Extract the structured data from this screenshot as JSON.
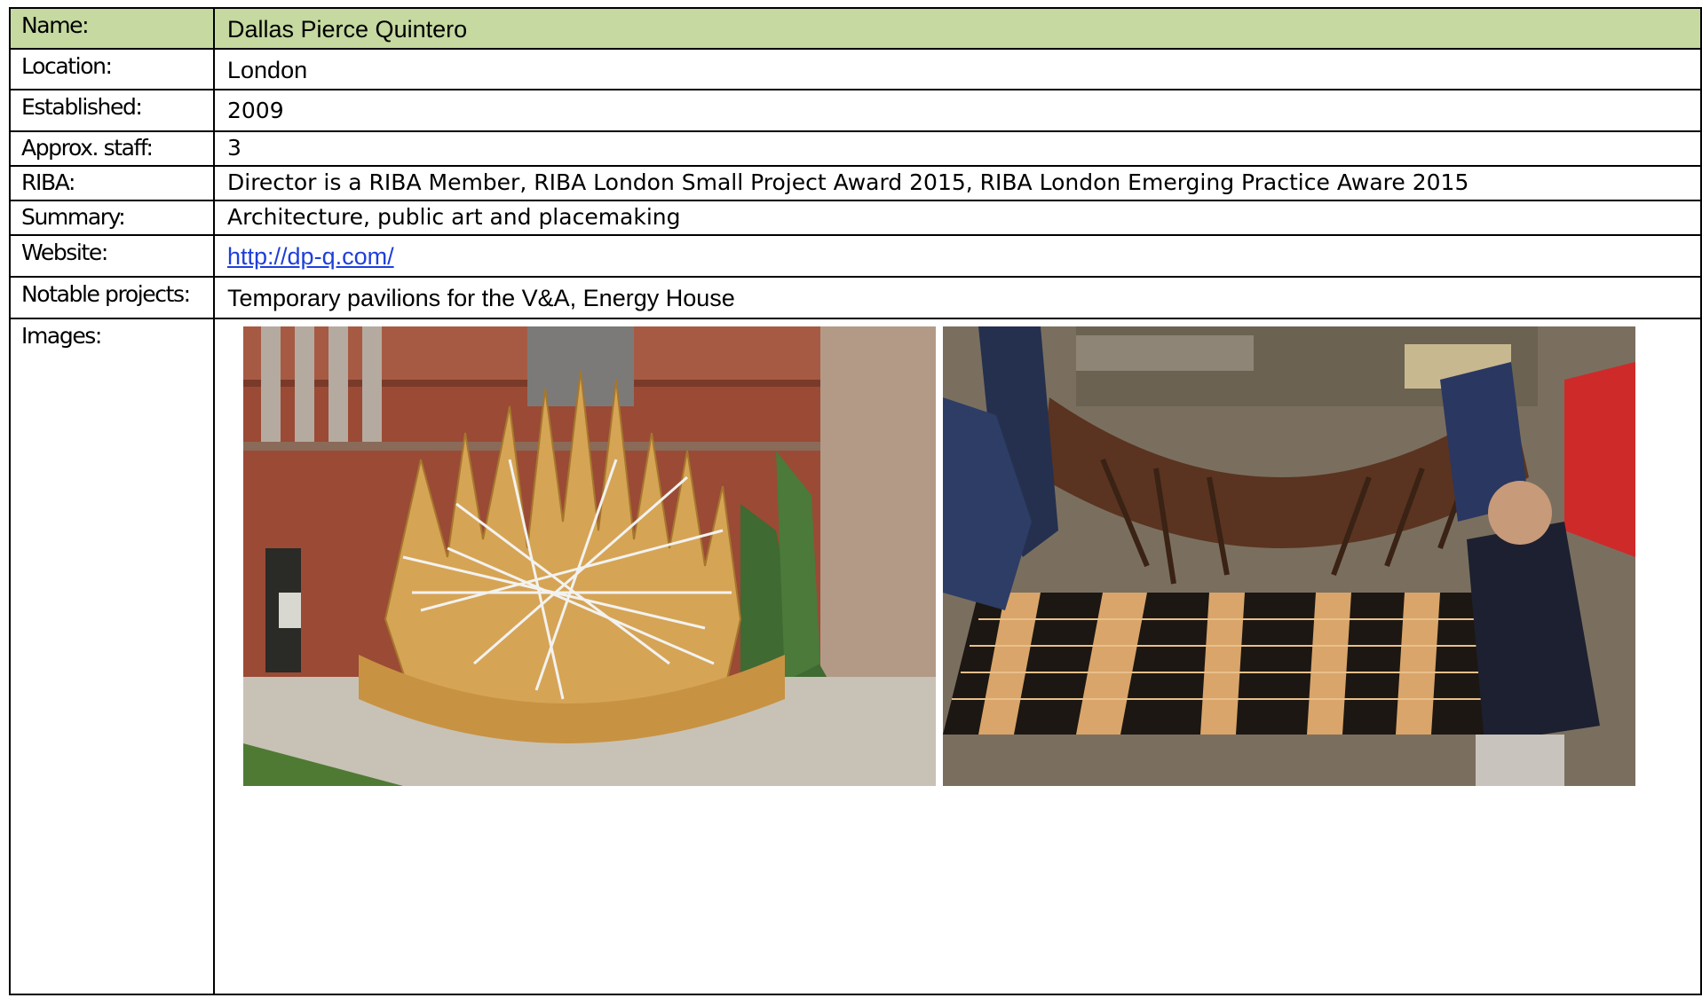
{
  "rows": [
    {
      "label": "Name:",
      "value": "Dallas Pierce Quintero"
    },
    {
      "label": "Location:",
      "value": "London"
    },
    {
      "label": "Established:",
      "value": "2009"
    },
    {
      "label": "Approx. staff:",
      "value": "3"
    },
    {
      "label": "RIBA:",
      "value": "Director is a RIBA Member, RIBA London Small Project Award 2015, RIBA London Emerging Practice Aware 2015"
    },
    {
      "label": "Summary:",
      "value": "Architecture, public art and placemaking"
    },
    {
      "label": "Website:",
      "value": "http://dp-q.com/"
    },
    {
      "label": "Notable projects:",
      "value": "Temporary pavilions for the V&A, Energy House"
    },
    {
      "label": "Images:"
    }
  ],
  "colors": {
    "header_fill": "#c5d9a0",
    "link": "#1f3fd8",
    "border": "#000000"
  },
  "images": [
    {
      "name": "pavilion-photo"
    },
    {
      "name": "workshop-photo"
    }
  ]
}
